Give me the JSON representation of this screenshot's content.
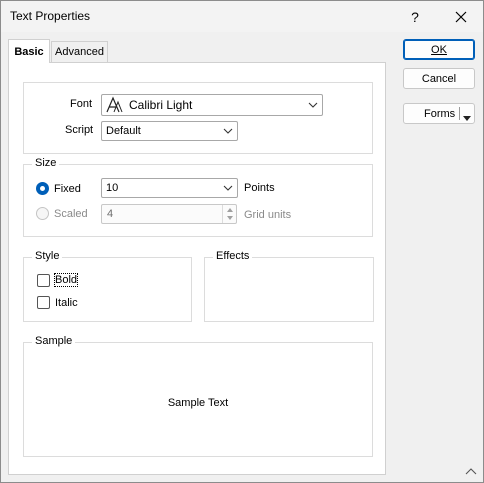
{
  "window": {
    "title": "Text Properties",
    "help_glyph": "?",
    "close_glyph": "✕"
  },
  "tabs": [
    {
      "label": "Basic",
      "selected": true
    },
    {
      "label": "Advanced",
      "selected": false
    }
  ],
  "font_group": {
    "font_label": "Font",
    "font_value": "Calibri Light",
    "script_label": "Script",
    "script_value": "Default"
  },
  "size_group": {
    "legend": "Size",
    "fixed_label": "Fixed",
    "fixed_value": "10",
    "fixed_unit": "Points",
    "scaled_label": "Scaled",
    "scaled_value": "4",
    "scaled_unit": "Grid units"
  },
  "style_group": {
    "legend": "Style",
    "bold_label": "Bold",
    "italic_label": "Italic",
    "bold_checked": false,
    "italic_checked": false
  },
  "effects_group": {
    "legend": "Effects"
  },
  "sample_group": {
    "legend": "Sample",
    "text": "Sample Text"
  },
  "buttons": {
    "ok_label": "OK",
    "cancel_label": "Cancel",
    "forms_label": "Forms"
  },
  "colors": {
    "accent": "#005fb8",
    "panel": "#ffffff",
    "window": "#f0f0f0"
  },
  "icons": [
    "font-icon",
    "chevron-down-icon",
    "help-icon",
    "close-icon",
    "size-grip-icon"
  ]
}
